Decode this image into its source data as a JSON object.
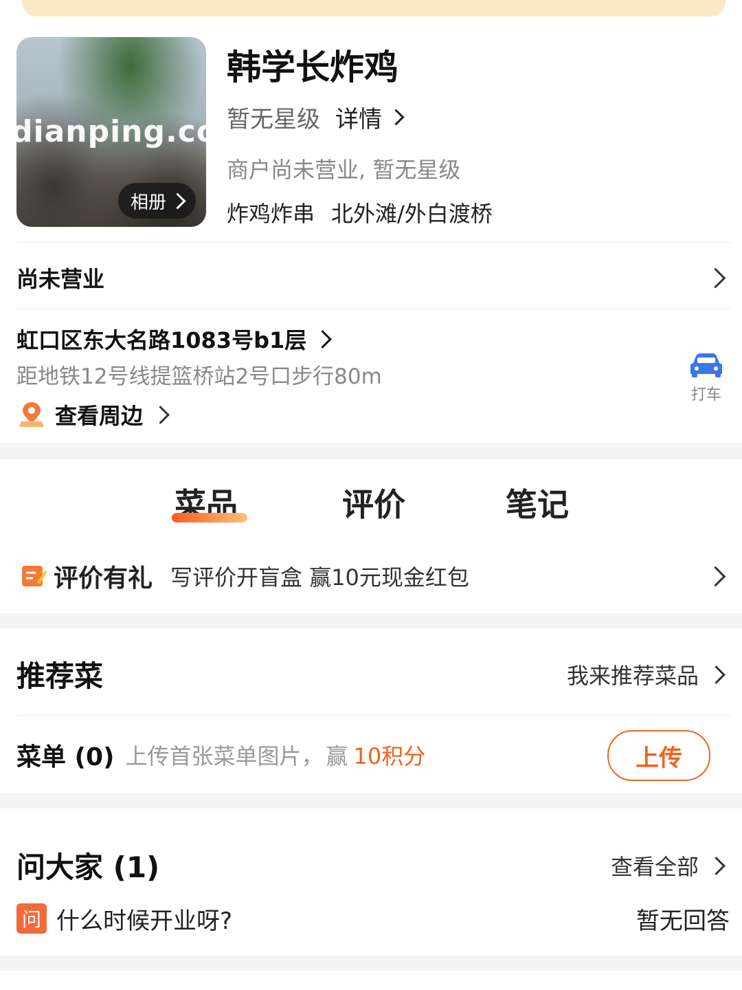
{
  "header": {
    "photo_watermark": "dianping.com",
    "album_label": "相册",
    "shop_name": "韩学长炸鸡",
    "rating_text": "暂无星级",
    "detail_label": "详情",
    "status_line": "商户尚未营业, 暂无星级",
    "category": "炸鸡炸串",
    "area": "北外滩/外白渡桥"
  },
  "hours": {
    "label": "尚未营业"
  },
  "address": {
    "main": "虹口区东大名路1083号b1层",
    "distance": "距地铁12号线提篮桥站2号口步行80m",
    "nearby_label": "查看周边",
    "taxi_label": "打车"
  },
  "tabs": [
    {
      "label": "菜品",
      "active": true
    },
    {
      "label": "评价",
      "active": false
    },
    {
      "label": "笔记",
      "active": false
    }
  ],
  "promo": {
    "title": "评价有礼",
    "text": "写评价开盲盒 赢10元现金红包"
  },
  "recommended": {
    "title": "推荐菜",
    "link": "我来推荐菜品"
  },
  "menu": {
    "label": "菜单 (0)",
    "hint": "上传首张菜单图片，",
    "reward_prefix": "赢",
    "reward_points": "10积分",
    "upload_label": "上传"
  },
  "qa": {
    "title": "问大家 (1)",
    "link": "查看全部",
    "badge": "问",
    "question": "什么时候开业呀?",
    "answer": "暂无回答"
  },
  "colors": {
    "accent": "#f0641e",
    "banner": "#fbe8c4",
    "taxi_blue": "#3a78e8"
  }
}
